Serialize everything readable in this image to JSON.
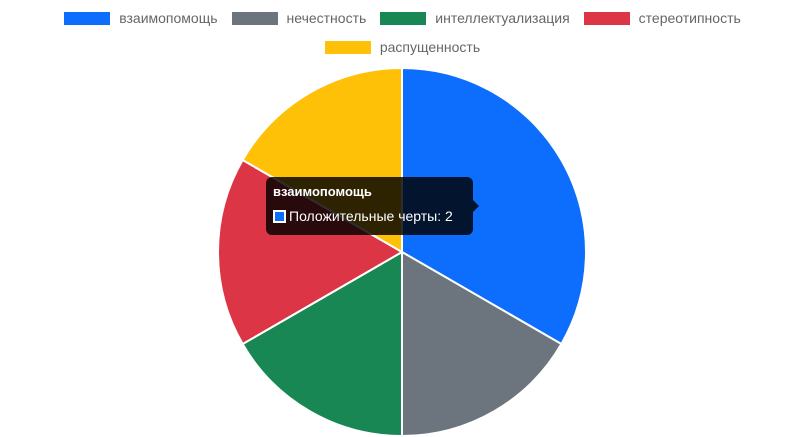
{
  "chart_data": {
    "type": "pie",
    "categories": [
      "взаимопомощь",
      "нечестность",
      "интеллектуализация",
      "стереотипность",
      "распущенность"
    ],
    "series": [
      {
        "name": "Положительные черты",
        "values": [
          2,
          1,
          1,
          1,
          1
        ],
        "colors": [
          "#0d6efd",
          "#6c757d",
          "#198754",
          "#dc3545",
          "#ffc107"
        ]
      }
    ],
    "legend_position": "top"
  },
  "tooltip": {
    "title": "взаимопомощь",
    "label": "Положительные черты: 2",
    "color": "#0d6efd"
  }
}
